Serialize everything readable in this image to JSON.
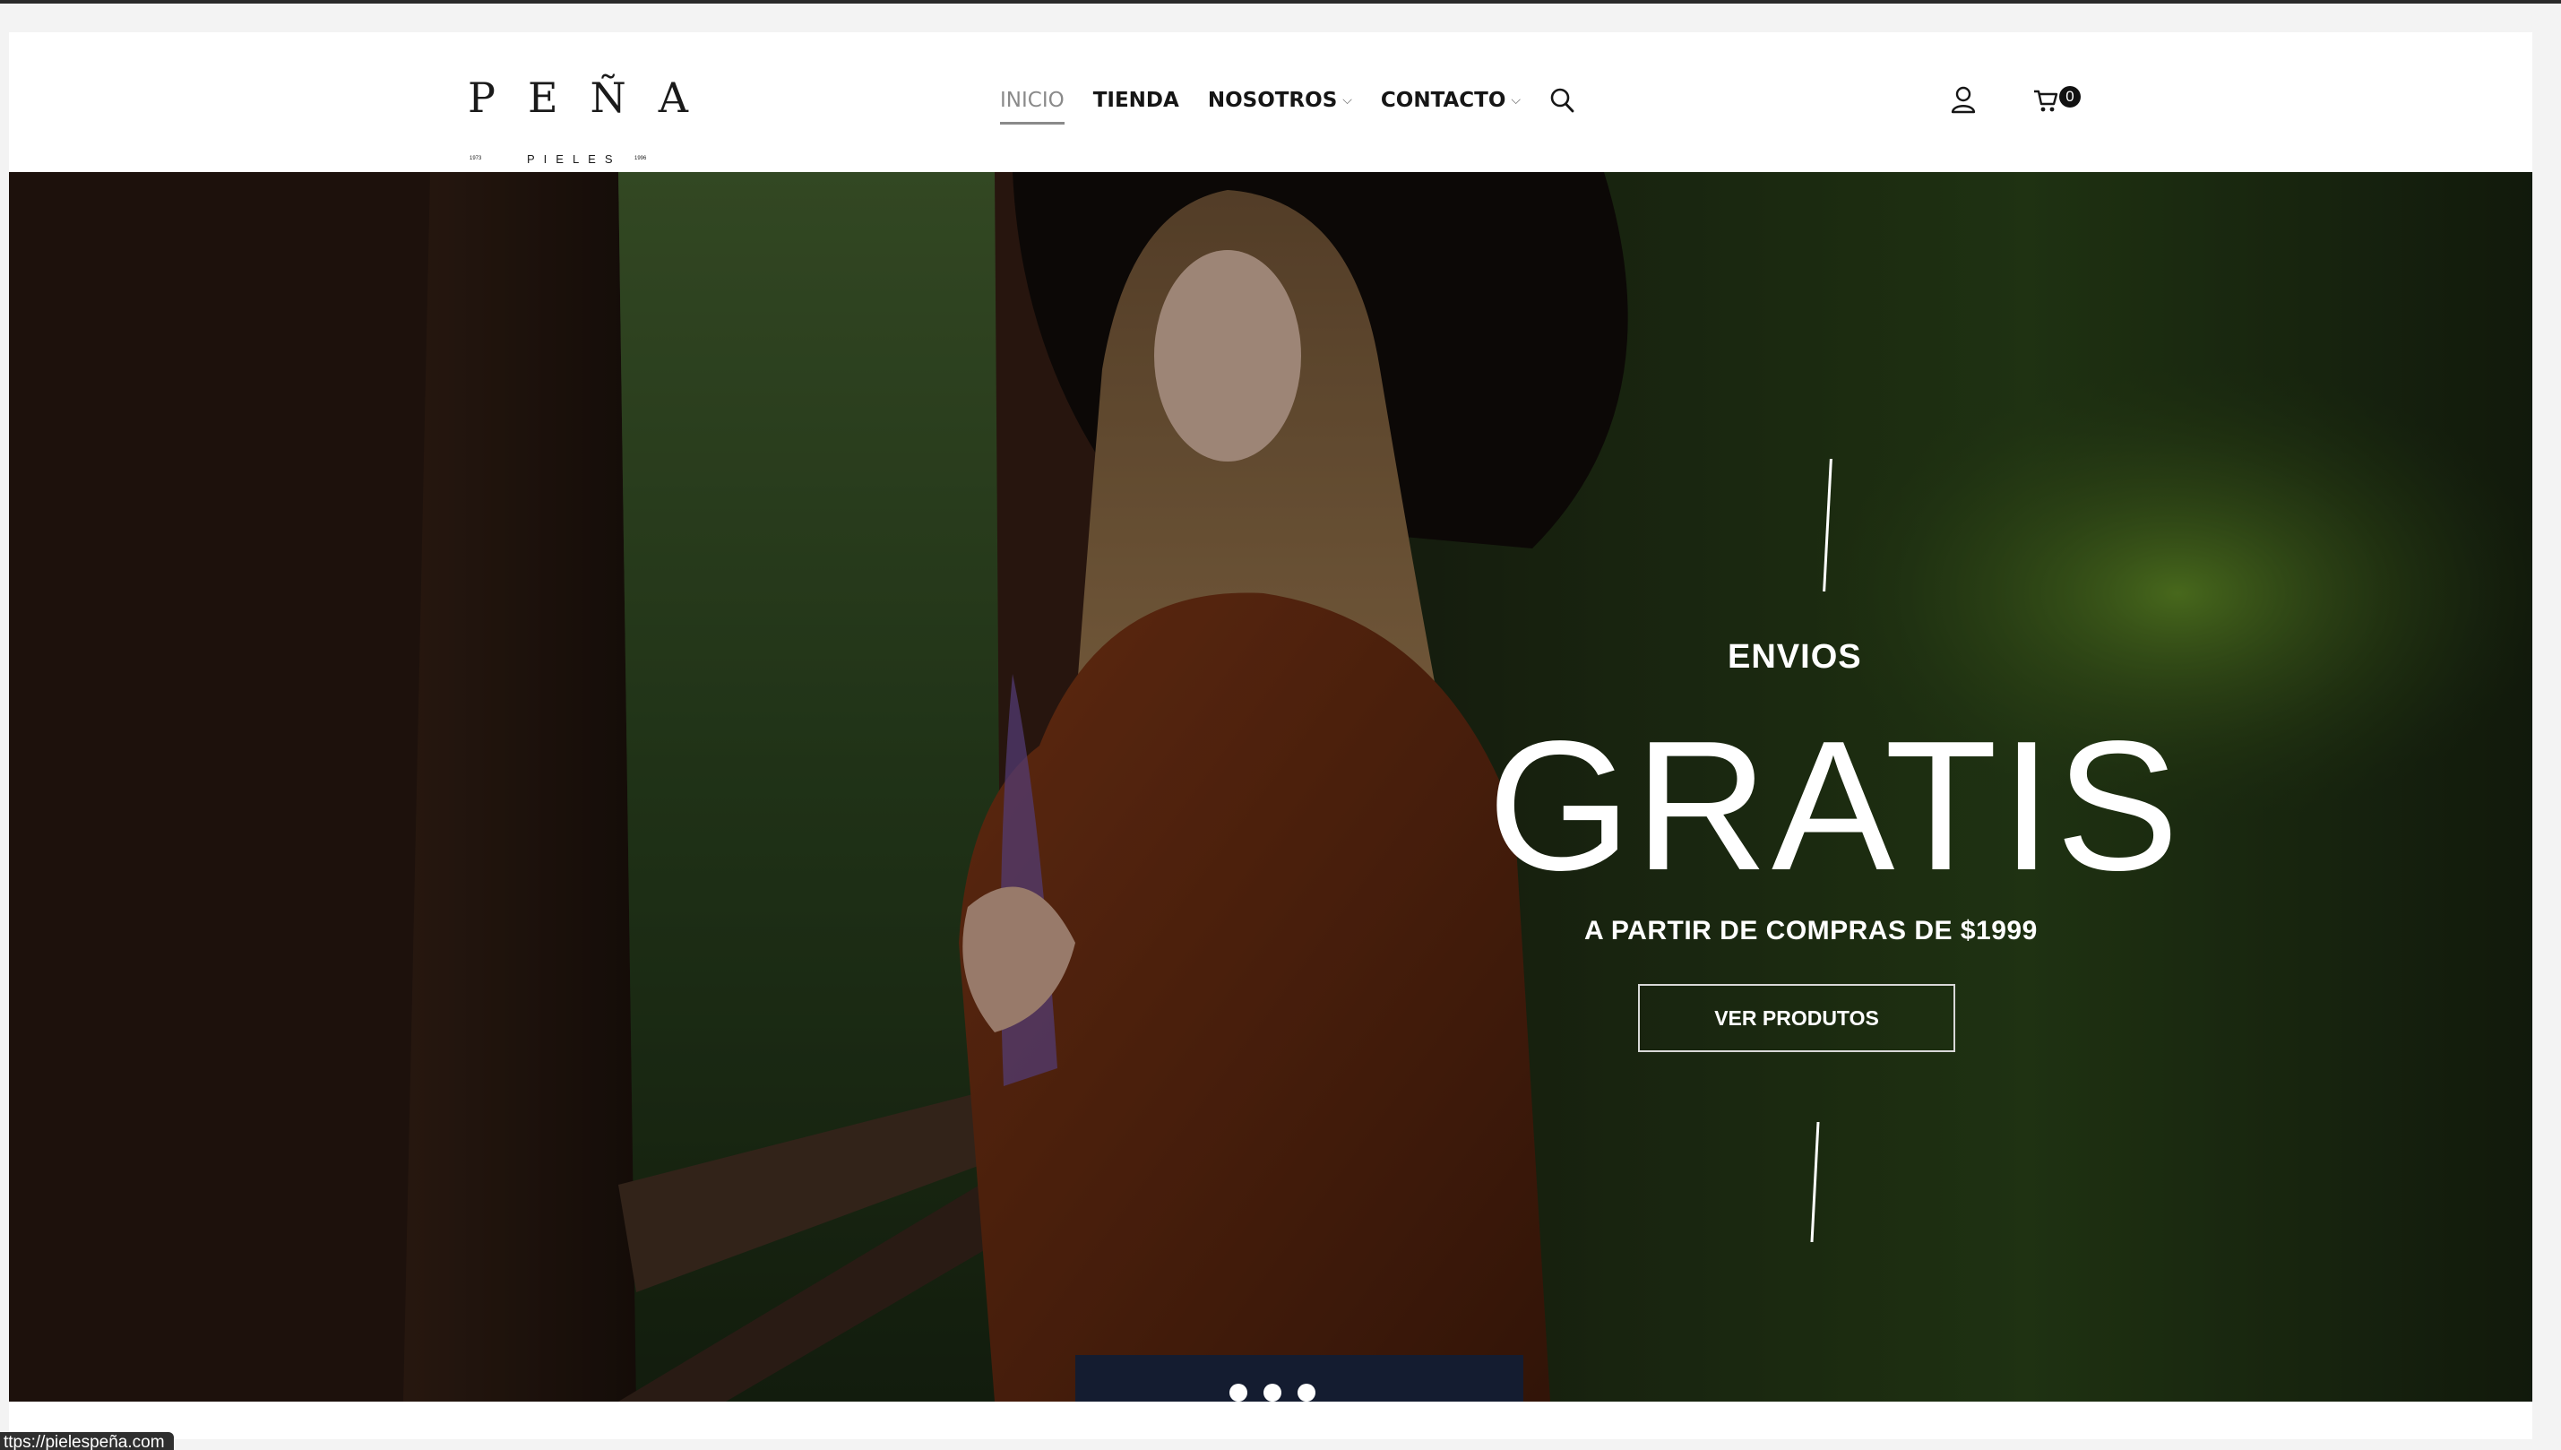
{
  "brand": {
    "name": "PEÑA",
    "subtitle": "PIELES",
    "year_left": "1973",
    "year_right": "1996"
  },
  "nav": {
    "items": [
      {
        "label": "INICIO",
        "active": true
      },
      {
        "label": "TIENDA"
      },
      {
        "label": "NOSOTROS",
        "dropdown": true
      },
      {
        "label": "CONTACTO",
        "dropdown": true
      }
    ],
    "search_icon": "search-icon"
  },
  "account": {
    "user_icon": "user-icon"
  },
  "cart": {
    "icon": "cart-icon",
    "count": "0"
  },
  "hero": {
    "kicker": "ENVIOS",
    "title": "GRATIS",
    "subtitle": "A PARTIR DE COMPRAS DE $1999",
    "button_label": "VER PRODUTOS",
    "slides": 3,
    "active_slide": 1
  },
  "status_bar": {
    "url": "ttps://pielespeña.com"
  },
  "colors": {
    "active_nav": "#8a8a8a",
    "text": "#161616",
    "badge": "#111111"
  }
}
